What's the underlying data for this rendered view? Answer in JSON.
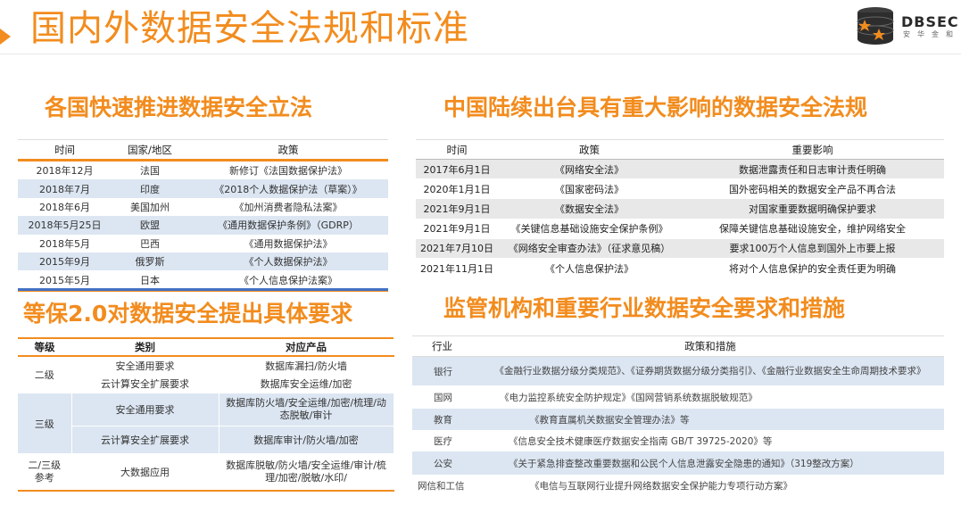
{
  "page": {
    "title": "国内外数据安全法规和标准"
  },
  "logo": {
    "name": "DBSEC",
    "sub": "安华金和"
  },
  "legislation": {
    "title": "各国快速推进数据安全立法",
    "headers": [
      "时间",
      "国家/地区",
      "政策"
    ],
    "rows": [
      [
        "2018年12月",
        "法国",
        "新修订《法国数据保护法》"
      ],
      [
        "2018年7月",
        "印度",
        "《2018个人数据保护法（草案）》"
      ],
      [
        "2018年6月",
        "美国加州",
        "《加州消费者隐私法案》"
      ],
      [
        "2018年5月25日",
        "欧盟",
        "《通用数据保护条例》（GDRP）"
      ],
      [
        "2018年5月",
        "巴西",
        "《通用数据保护法》"
      ],
      [
        "2015年9月",
        "俄罗斯",
        "《个人数据保护法》"
      ],
      [
        "2015年5月",
        "日本",
        "《个人信息保护法案》"
      ]
    ]
  },
  "china": {
    "title": "中国陆续出台具有重大影响的数据安全法规",
    "headers": [
      "时间",
      "政策",
      "重要影响"
    ],
    "rows": [
      [
        "2017年6月1日",
        "《网络安全法》",
        "数据泄露责任和日志审计责任明确"
      ],
      [
        "2020年1月1日",
        "《国家密码法》",
        "国外密码相关的数据安全产品不再合法"
      ],
      [
        "2021年9月1日",
        "《数据安全法》",
        "对国家重要数据明确保护要求"
      ],
      [
        "2021年9月1日",
        "《关键信息基础设施安全保护条例》",
        "保障关键信息基础设施安全，维护网络安全"
      ],
      [
        "2021年7月10日",
        "《网络安全审查办法》（征求意见稿）",
        "要求100万个人信息到国外上市要上报"
      ],
      [
        "2021年11月1日",
        "《个人信息保护法》",
        "将对个人信息保护的安全责任更为明确"
      ]
    ]
  },
  "mlps": {
    "title": "等保2.0对数据安全提出具体要求",
    "headers": [
      "等级",
      "类别",
      "对应产品"
    ],
    "level2": "二级",
    "level3": "三级",
    "level23": "二/三级参考",
    "rows": [
      [
        "安全通用要求",
        "数据库漏扫/防火墙"
      ],
      [
        "云计算安全扩展要求",
        "数据库安全运维/加密"
      ],
      [
        "安全通用要求",
        "数据库防火墙/安全运维/加密/梳理/动态脱敏/审计"
      ],
      [
        "云计算安全扩展要求",
        "数据库审计/防火墙/加密"
      ],
      [
        "大数据应用",
        "数据库脱敏/防火墙/安全运维/审计/梳理/加密/脱敏/水印/"
      ]
    ]
  },
  "industry": {
    "title": "监管机构和重要行业数据安全要求和措施",
    "headers": [
      "行业",
      "政策和措施"
    ],
    "rows": [
      [
        "银行",
        "《金融行业数据分级分类规范》、《证券期货数据分级分类指引》、《金融行业数据安全生命周期技术要求》"
      ],
      [
        "国网",
        "《电力监控系统安全防护规定》《国网营销系统数据脱敏规范》"
      ],
      [
        "教育",
        "《教育直属机关数据安全管理办法》等"
      ],
      [
        "医疗",
        "《信息安全技术健康医疗数据安全指南 GB/T 39725-2020》等"
      ],
      [
        "公安",
        "《关于紧急排查整改重要数据和公民个人信息泄露安全隐患的通知》（319整改方案）"
      ],
      [
        "网信和工信",
        "《电信与互联网行业提升网络数据安全保护能力专项行动方案》"
      ]
    ]
  }
}
